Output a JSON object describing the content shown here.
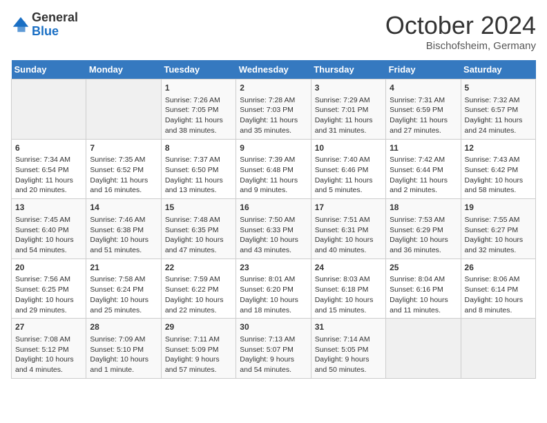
{
  "header": {
    "logo_general": "General",
    "logo_blue": "Blue",
    "month_title": "October 2024",
    "location": "Bischofsheim, Germany"
  },
  "weekdays": [
    "Sunday",
    "Monday",
    "Tuesday",
    "Wednesday",
    "Thursday",
    "Friday",
    "Saturday"
  ],
  "weeks": [
    [
      {
        "day": "",
        "content": ""
      },
      {
        "day": "",
        "content": ""
      },
      {
        "day": "1",
        "content": "Sunrise: 7:26 AM\nSunset: 7:05 PM\nDaylight: 11 hours and 38 minutes."
      },
      {
        "day": "2",
        "content": "Sunrise: 7:28 AM\nSunset: 7:03 PM\nDaylight: 11 hours and 35 minutes."
      },
      {
        "day": "3",
        "content": "Sunrise: 7:29 AM\nSunset: 7:01 PM\nDaylight: 11 hours and 31 minutes."
      },
      {
        "day": "4",
        "content": "Sunrise: 7:31 AM\nSunset: 6:59 PM\nDaylight: 11 hours and 27 minutes."
      },
      {
        "day": "5",
        "content": "Sunrise: 7:32 AM\nSunset: 6:57 PM\nDaylight: 11 hours and 24 minutes."
      }
    ],
    [
      {
        "day": "6",
        "content": "Sunrise: 7:34 AM\nSunset: 6:54 PM\nDaylight: 11 hours and 20 minutes."
      },
      {
        "day": "7",
        "content": "Sunrise: 7:35 AM\nSunset: 6:52 PM\nDaylight: 11 hours and 16 minutes."
      },
      {
        "day": "8",
        "content": "Sunrise: 7:37 AM\nSunset: 6:50 PM\nDaylight: 11 hours and 13 minutes."
      },
      {
        "day": "9",
        "content": "Sunrise: 7:39 AM\nSunset: 6:48 PM\nDaylight: 11 hours and 9 minutes."
      },
      {
        "day": "10",
        "content": "Sunrise: 7:40 AM\nSunset: 6:46 PM\nDaylight: 11 hours and 5 minutes."
      },
      {
        "day": "11",
        "content": "Sunrise: 7:42 AM\nSunset: 6:44 PM\nDaylight: 11 hours and 2 minutes."
      },
      {
        "day": "12",
        "content": "Sunrise: 7:43 AM\nSunset: 6:42 PM\nDaylight: 10 hours and 58 minutes."
      }
    ],
    [
      {
        "day": "13",
        "content": "Sunrise: 7:45 AM\nSunset: 6:40 PM\nDaylight: 10 hours and 54 minutes."
      },
      {
        "day": "14",
        "content": "Sunrise: 7:46 AM\nSunset: 6:38 PM\nDaylight: 10 hours and 51 minutes."
      },
      {
        "day": "15",
        "content": "Sunrise: 7:48 AM\nSunset: 6:35 PM\nDaylight: 10 hours and 47 minutes."
      },
      {
        "day": "16",
        "content": "Sunrise: 7:50 AM\nSunset: 6:33 PM\nDaylight: 10 hours and 43 minutes."
      },
      {
        "day": "17",
        "content": "Sunrise: 7:51 AM\nSunset: 6:31 PM\nDaylight: 10 hours and 40 minutes."
      },
      {
        "day": "18",
        "content": "Sunrise: 7:53 AM\nSunset: 6:29 PM\nDaylight: 10 hours and 36 minutes."
      },
      {
        "day": "19",
        "content": "Sunrise: 7:55 AM\nSunset: 6:27 PM\nDaylight: 10 hours and 32 minutes."
      }
    ],
    [
      {
        "day": "20",
        "content": "Sunrise: 7:56 AM\nSunset: 6:25 PM\nDaylight: 10 hours and 29 minutes."
      },
      {
        "day": "21",
        "content": "Sunrise: 7:58 AM\nSunset: 6:24 PM\nDaylight: 10 hours and 25 minutes."
      },
      {
        "day": "22",
        "content": "Sunrise: 7:59 AM\nSunset: 6:22 PM\nDaylight: 10 hours and 22 minutes."
      },
      {
        "day": "23",
        "content": "Sunrise: 8:01 AM\nSunset: 6:20 PM\nDaylight: 10 hours and 18 minutes."
      },
      {
        "day": "24",
        "content": "Sunrise: 8:03 AM\nSunset: 6:18 PM\nDaylight: 10 hours and 15 minutes."
      },
      {
        "day": "25",
        "content": "Sunrise: 8:04 AM\nSunset: 6:16 PM\nDaylight: 10 hours and 11 minutes."
      },
      {
        "day": "26",
        "content": "Sunrise: 8:06 AM\nSunset: 6:14 PM\nDaylight: 10 hours and 8 minutes."
      }
    ],
    [
      {
        "day": "27",
        "content": "Sunrise: 7:08 AM\nSunset: 5:12 PM\nDaylight: 10 hours and 4 minutes."
      },
      {
        "day": "28",
        "content": "Sunrise: 7:09 AM\nSunset: 5:10 PM\nDaylight: 10 hours and 1 minute."
      },
      {
        "day": "29",
        "content": "Sunrise: 7:11 AM\nSunset: 5:09 PM\nDaylight: 9 hours and 57 minutes."
      },
      {
        "day": "30",
        "content": "Sunrise: 7:13 AM\nSunset: 5:07 PM\nDaylight: 9 hours and 54 minutes."
      },
      {
        "day": "31",
        "content": "Sunrise: 7:14 AM\nSunset: 5:05 PM\nDaylight: 9 hours and 50 minutes."
      },
      {
        "day": "",
        "content": ""
      },
      {
        "day": "",
        "content": ""
      }
    ]
  ]
}
